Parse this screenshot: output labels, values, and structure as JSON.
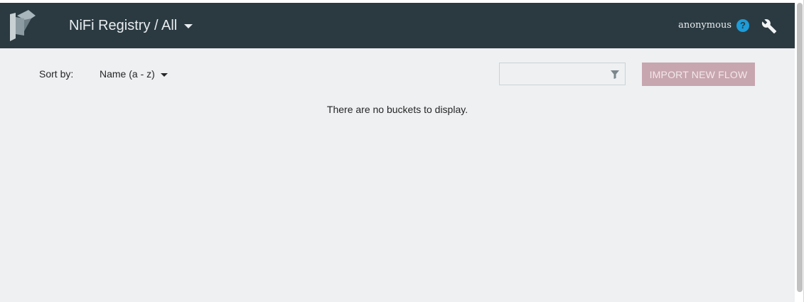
{
  "header": {
    "title": "NiFi Registry / All",
    "user": "anonymous",
    "help_glyph": "?",
    "icons": [
      "nifi-registry-logo",
      "chevron-down-icon",
      "help-icon",
      "wrench-icon"
    ]
  },
  "toolbar": {
    "sort_label": "Sort by:",
    "sort_value": "Name (a - z)",
    "filter_value": "",
    "filter_placeholder": "",
    "import_button": "IMPORT NEW FLOW"
  },
  "main": {
    "empty_message": "There are no buckets to display."
  },
  "colors": {
    "header_bg": "#2b3a41",
    "page_bg": "#eef0f2",
    "help_accent": "#1d9cd9",
    "import_button_bg": "#c7a6af"
  }
}
